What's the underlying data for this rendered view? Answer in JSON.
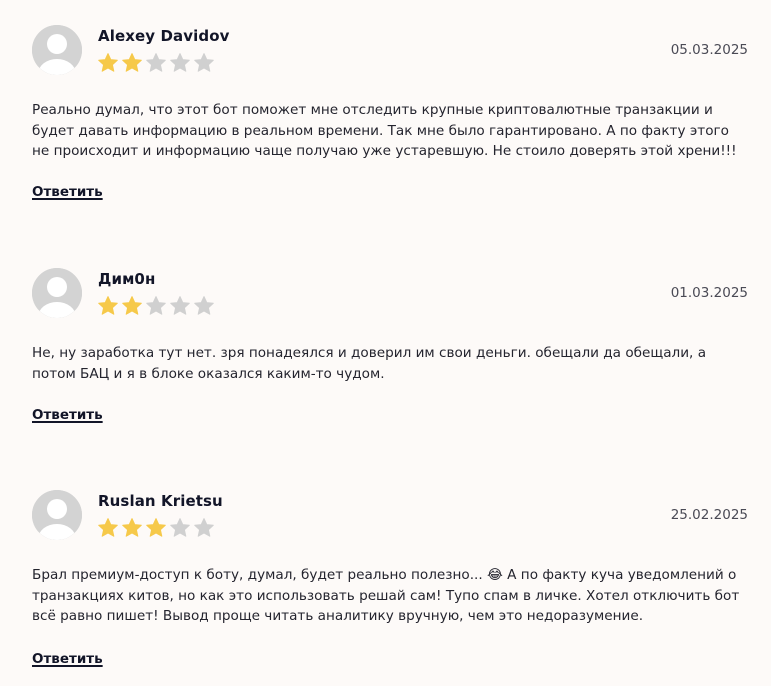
{
  "reviews": [
    {
      "author": "Alexey Davidov",
      "date": "05.03.2025",
      "rating": 2,
      "max_rating": 5,
      "text": "Реально думал, что этот бот поможет мне отследить крупные криптовалютные транзакции и будет давать информацию в реальном времени. Так мне было гарантировано. А по факту этого не происходит и информацию чаще получаю уже устаревшую. Не стоило доверять этой хрени!!!",
      "reply_label": "Ответить"
    },
    {
      "author": "Дим0н",
      "date": "01.03.2025",
      "rating": 2,
      "max_rating": 5,
      "text": "Не, ну заработка тут нет. зря понадеялся и доверил им свои деньги. обещали да обещали, а потом БАЦ и я в блоке оказался каким-то чудом.",
      "reply_label": "Ответить"
    },
    {
      "author": "Ruslan Krietsu",
      "date": "25.02.2025",
      "rating": 3,
      "max_rating": 5,
      "text": "Брал премиум-доступ к боту, думал, будет реально полезно... 😂 А по факту куча уведомлений о транзакциях китов, но как это использовать решай сам! Тупо спам в личке. Хотел отключить бот всё равно пишет! Вывод проще читать аналитику вручную, чем это недоразумение.",
      "reply_label": "Ответить"
    }
  ],
  "colors": {
    "star_filled": "#f6c94a",
    "star_empty": "#d0d0d0",
    "avatar_bg": "#d3d3d3",
    "avatar_figure": "#ffffff",
    "page_bg": "#fdfaf8"
  }
}
